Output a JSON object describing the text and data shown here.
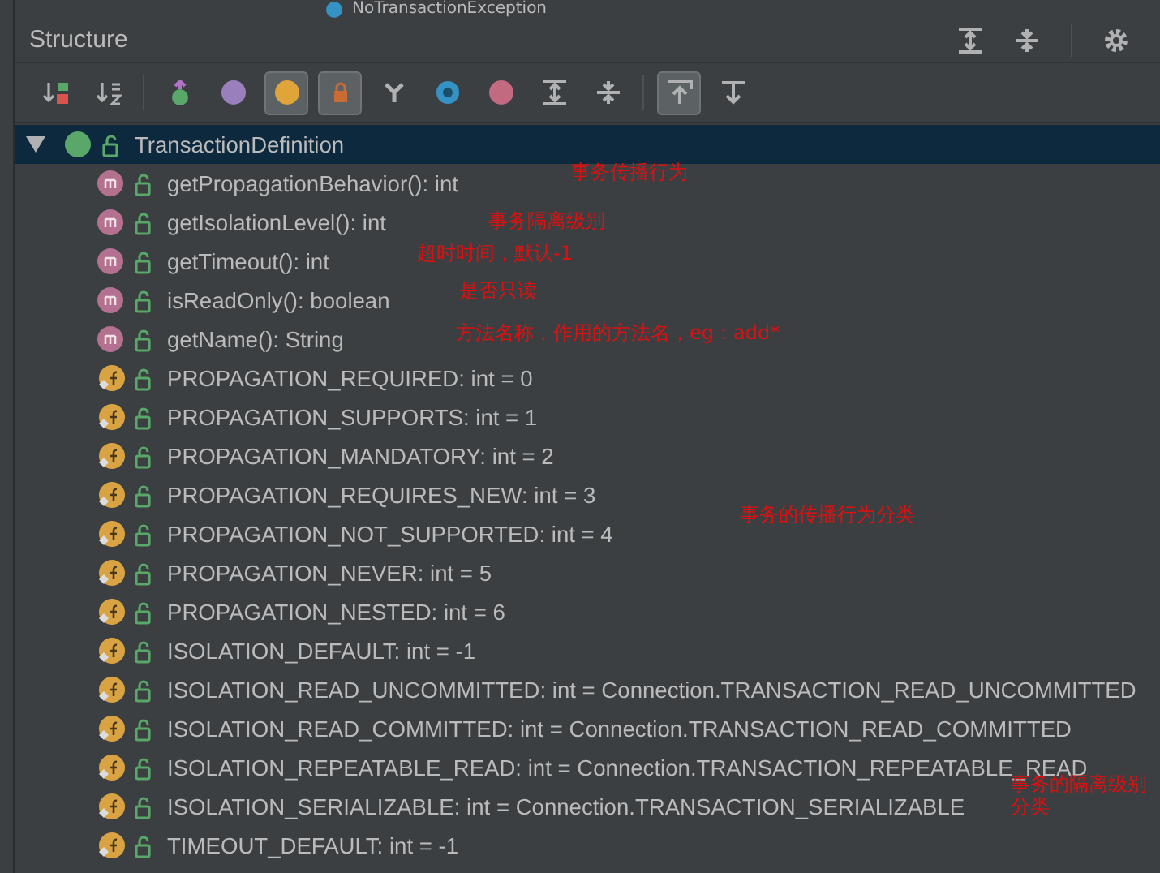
{
  "top_item": {
    "label": "NoTransactionException"
  },
  "panel": {
    "title": "Structure"
  },
  "toolbar": [
    {
      "kind": "sort-visibility",
      "selected": false
    },
    {
      "kind": "sort-alpha",
      "selected": false
    },
    {
      "kind": "inherited",
      "selected": false
    },
    {
      "kind": "properties",
      "selected": false
    },
    {
      "kind": "fields",
      "selected": true
    },
    {
      "kind": "non-public",
      "selected": true
    },
    {
      "kind": "hierarchy",
      "selected": false
    },
    {
      "kind": "anonymous",
      "selected": false
    },
    {
      "kind": "lambdas",
      "selected": false
    },
    {
      "kind": "expand",
      "selected": false
    },
    {
      "kind": "collapse",
      "selected": false
    },
    {
      "kind": "autoscroll-to",
      "selected": true
    },
    {
      "kind": "autoscroll-from",
      "selected": false
    }
  ],
  "tree": {
    "label": "TransactionDefinition",
    "kind": "interface",
    "expanded": true,
    "selected": true,
    "children": [
      {
        "kind": "method",
        "label": "getPropagationBehavior(): int"
      },
      {
        "kind": "method",
        "label": "getIsolationLevel(): int"
      },
      {
        "kind": "method",
        "label": "getTimeout(): int"
      },
      {
        "kind": "method",
        "label": "isReadOnly(): boolean"
      },
      {
        "kind": "method",
        "label": "getName(): String"
      },
      {
        "kind": "field",
        "label": "PROPAGATION_REQUIRED: int = 0"
      },
      {
        "kind": "field",
        "label": "PROPAGATION_SUPPORTS: int = 1"
      },
      {
        "kind": "field",
        "label": "PROPAGATION_MANDATORY: int = 2"
      },
      {
        "kind": "field",
        "label": "PROPAGATION_REQUIRES_NEW: int = 3"
      },
      {
        "kind": "field",
        "label": "PROPAGATION_NOT_SUPPORTED: int = 4"
      },
      {
        "kind": "field",
        "label": "PROPAGATION_NEVER: int = 5"
      },
      {
        "kind": "field",
        "label": "PROPAGATION_NESTED: int = 6"
      },
      {
        "kind": "field",
        "label": "ISOLATION_DEFAULT: int = -1"
      },
      {
        "kind": "field",
        "label": "ISOLATION_READ_UNCOMMITTED: int = Connection.TRANSACTION_READ_UNCOMMITTED"
      },
      {
        "kind": "field",
        "label": "ISOLATION_READ_COMMITTED: int = Connection.TRANSACTION_READ_COMMITTED"
      },
      {
        "kind": "field",
        "label": "ISOLATION_REPEATABLE_READ: int = Connection.TRANSACTION_REPEATABLE_READ"
      },
      {
        "kind": "field",
        "label": "ISOLATION_SERIALIZABLE: int = Connection.TRANSACTION_SERIALIZABLE"
      },
      {
        "kind": "field",
        "label": "TIMEOUT_DEFAULT: int = -1"
      }
    ]
  },
  "annotations": [
    "事务传播行为",
    "事务隔离级别",
    "超时时间，默认-1",
    "是否只读",
    "方法名称，作用的方法名，eg：add*",
    "事务的传播行为分类",
    "事务的隔离级别分类"
  ]
}
